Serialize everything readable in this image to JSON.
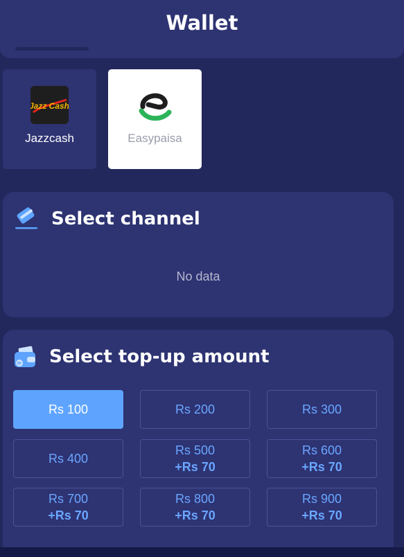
{
  "header": {
    "title": "Wallet"
  },
  "payment_methods": [
    {
      "label": "Jazzcash",
      "logo_text": "Jazz Cash",
      "icon": "jazzcash-logo-icon",
      "selected": false
    },
    {
      "label": "Easypaisa",
      "icon": "easypaisa-logo-icon",
      "selected": true
    }
  ],
  "channel": {
    "title": "Select channel",
    "icon": "card-icon",
    "empty_text": "No data"
  },
  "amount": {
    "title": "Select top-up amount",
    "icon": "wallet-icon",
    "options": [
      {
        "label": "Rs 100",
        "bonus": "",
        "selected": true
      },
      {
        "label": "Rs 200",
        "bonus": "",
        "selected": false
      },
      {
        "label": "Rs 300",
        "bonus": "",
        "selected": false
      },
      {
        "label": "Rs 400",
        "bonus": "",
        "selected": false
      },
      {
        "label": "Rs 500",
        "bonus": "+Rs 70",
        "selected": false
      },
      {
        "label": "Rs 600",
        "bonus": "+Rs 70",
        "selected": false
      },
      {
        "label": "Rs 700",
        "bonus": "+Rs 70",
        "selected": false
      },
      {
        "label": "Rs 800",
        "bonus": "+Rs 70",
        "selected": false
      },
      {
        "label": "Rs 900",
        "bonus": "+Rs 70",
        "selected": false
      }
    ]
  },
  "colors": {
    "background": "#22285c",
    "card": "#2e3372",
    "accent": "#5ea4ff",
    "accent_text": "#6aa6ff",
    "easypaisa_green": "#2cb45a"
  }
}
